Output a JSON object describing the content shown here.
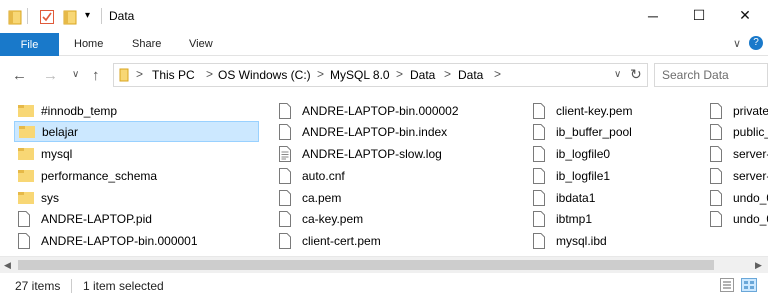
{
  "window": {
    "title": "Data",
    "controls": {
      "minimize": "─",
      "maximize": "☐",
      "close": "✕"
    }
  },
  "ribbon": {
    "tabs": [
      "File",
      "Home",
      "Share",
      "View"
    ],
    "collapse_glyph": "∨",
    "help_glyph": "?"
  },
  "nav": {
    "back": "←",
    "forward": "→",
    "recent": "∨",
    "up": "↑",
    "refresh": "↻"
  },
  "address": {
    "crumbs": [
      "This PC",
      "OS Windows (C:)",
      "MySQL 8.0",
      "Data",
      "Data"
    ],
    "separator": ">",
    "dropdown": "∨"
  },
  "search": {
    "placeholder": "Search Data",
    "icon": "search-icon"
  },
  "files": [
    {
      "name": "#innodb_temp",
      "type": "folder"
    },
    {
      "name": "belajar",
      "type": "folder",
      "selected": true
    },
    {
      "name": "mysql",
      "type": "folder"
    },
    {
      "name": "performance_schema",
      "type": "folder"
    },
    {
      "name": "sys",
      "type": "folder"
    },
    {
      "name": "ANDRE-LAPTOP.pid",
      "type": "file"
    },
    {
      "name": "ANDRE-LAPTOP-bin.000001",
      "type": "file"
    },
    {
      "name": "ANDRE-LAPTOP-bin.000002",
      "type": "file"
    },
    {
      "name": "ANDRE-LAPTOP-bin.index",
      "type": "file"
    },
    {
      "name": "ANDRE-LAPTOP-slow.log",
      "type": "text"
    },
    {
      "name": "auto.cnf",
      "type": "file"
    },
    {
      "name": "ca.pem",
      "type": "file"
    },
    {
      "name": "ca-key.pem",
      "type": "file"
    },
    {
      "name": "client-cert.pem",
      "type": "file"
    },
    {
      "name": "client-key.pem",
      "type": "file"
    },
    {
      "name": "ib_buffer_pool",
      "type": "file"
    },
    {
      "name": "ib_logfile0",
      "type": "file"
    },
    {
      "name": "ib_logfile1",
      "type": "file"
    },
    {
      "name": "ibdata1",
      "type": "file"
    },
    {
      "name": "ibtmp1",
      "type": "file"
    },
    {
      "name": "mysql.ibd",
      "type": "file"
    },
    {
      "name": "private",
      "type": "file"
    },
    {
      "name": "public_",
      "type": "file"
    },
    {
      "name": "server-",
      "type": "file"
    },
    {
      "name": "server-",
      "type": "file"
    },
    {
      "name": "undo_0",
      "type": "file"
    },
    {
      "name": "undo_0",
      "type": "file"
    }
  ],
  "scrollbar": {
    "left": "◀",
    "right": "▶"
  },
  "status": {
    "count": "27 items",
    "selection": "1 item selected"
  },
  "colors": {
    "accent": "#1979ca",
    "selection": "#cce8ff",
    "folder": "#f8d775"
  }
}
